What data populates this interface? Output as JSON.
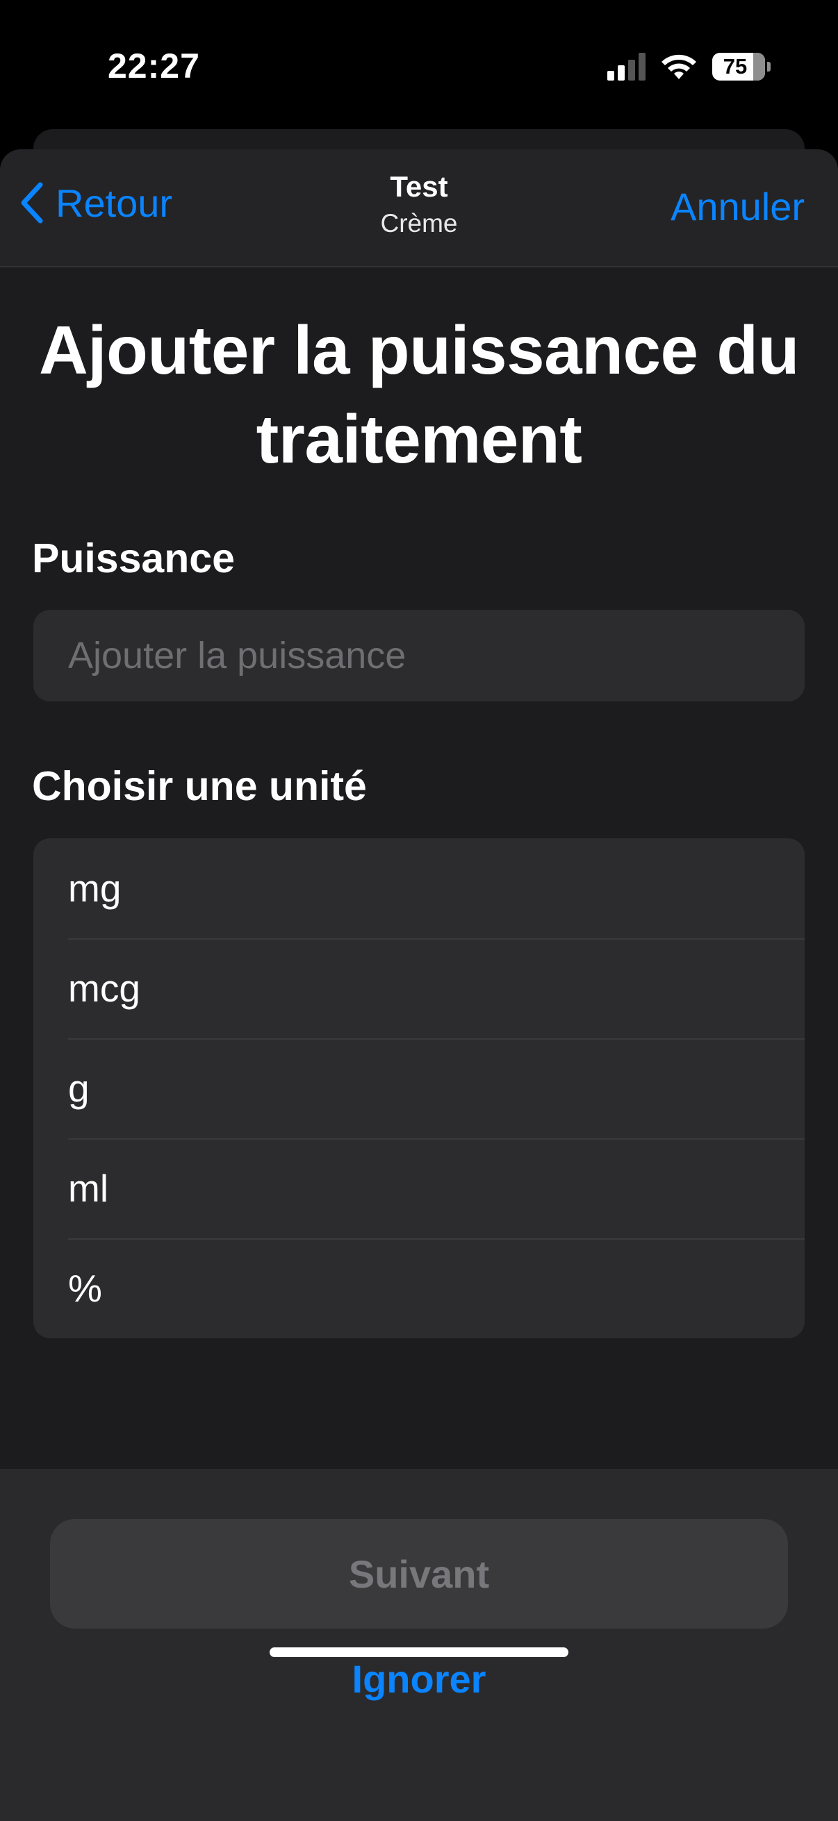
{
  "status_bar": {
    "time": "22:27",
    "battery_percent": "75",
    "signal_bars_active": 2,
    "signal_bars_total": 4,
    "wifi_icon": "wifi-icon"
  },
  "nav": {
    "back_label": "Retour",
    "title": "Test",
    "subtitle": "Crème",
    "cancel_label": "Annuler"
  },
  "page": {
    "title": "Ajouter la puissance du traitement"
  },
  "strength": {
    "label": "Puissance",
    "placeholder": "Ajouter la puissance",
    "value": ""
  },
  "units": {
    "label": "Choisir une unité",
    "options": [
      "mg",
      "mcg",
      "g",
      "ml",
      "%"
    ]
  },
  "footer": {
    "next_label": "Suivant",
    "skip_label": "Ignorer"
  },
  "colors": {
    "accent": "#0a84ff",
    "background": "#1c1c1e",
    "card": "#2c2c2e"
  }
}
